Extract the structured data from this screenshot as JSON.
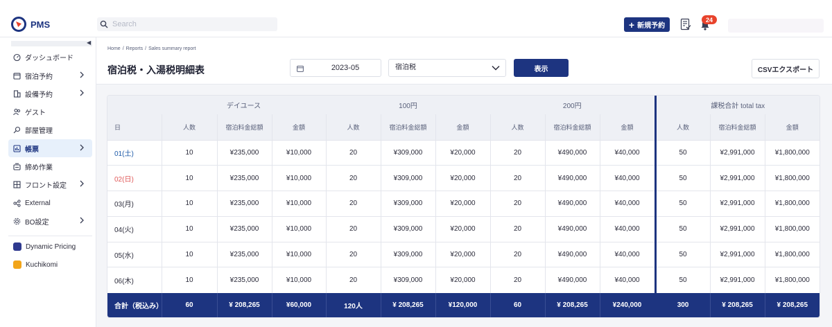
{
  "app": {
    "name": "PMS"
  },
  "topbar": {
    "search_placeholder": "Search",
    "new_reservation_label": "新規予約",
    "notification_count": "24"
  },
  "sidebar": {
    "items": [
      {
        "label": "ダッシュボード",
        "icon": "dashboard-icon",
        "chevron": false,
        "active": false
      },
      {
        "label": "宿泊予約",
        "icon": "calendar-icon",
        "chevron": true,
        "active": false
      },
      {
        "label": "設備予約",
        "icon": "building-icon",
        "chevron": true,
        "active": false
      },
      {
        "label": "ゲスト",
        "icon": "guests-icon",
        "chevron": false,
        "active": false
      },
      {
        "label": "部屋管理",
        "icon": "key-icon",
        "chevron": false,
        "active": false
      },
      {
        "label": "帳票",
        "icon": "report-icon",
        "chevron": true,
        "active": true
      },
      {
        "label": "締め作業",
        "icon": "register-icon",
        "chevron": false,
        "active": false
      },
      {
        "label": "フロント設定",
        "icon": "grid-icon",
        "chevron": true,
        "active": false
      },
      {
        "label": "External",
        "icon": "share-icon",
        "chevron": false,
        "active": false
      },
      {
        "label": "BO設定",
        "icon": "gear-icon",
        "chevron": true,
        "active": false
      }
    ],
    "apps": [
      {
        "label": "Dynamic Pricing",
        "icon": "dynamic-pricing-icon",
        "color": "#2f3a8f"
      },
      {
        "label": "Kuchikomi",
        "icon": "kuchikomi-icon",
        "color": "#f2a51a"
      }
    ]
  },
  "breadcrumb": [
    "Home",
    "Reports",
    "Sales summary report"
  ],
  "page": {
    "title": "宿泊税・入湯税明細表",
    "month_value": "2023-05",
    "tax_type_value": "宿泊税",
    "show_label": "表示",
    "csv_label": "CSVエクスポート"
  },
  "table": {
    "groups": [
      "デイユース",
      "100円",
      "200円",
      "課税合計 total tax"
    ],
    "day_header": "日",
    "sub_headers": [
      "人数",
      "宿泊料金総額",
      "金額"
    ],
    "rows": [
      {
        "day": "01(土)",
        "style": "blue",
        "cells": [
          "10",
          "¥235,000",
          "¥10,000",
          "20",
          "¥309,000",
          "¥20,000",
          "20",
          "¥490,000",
          "¥40,000",
          "50",
          "¥2,991,000",
          "¥1,800,000"
        ]
      },
      {
        "day": "02(日)",
        "style": "red",
        "cells": [
          "10",
          "¥235,000",
          "¥10,000",
          "20",
          "¥309,000",
          "¥20,000",
          "20",
          "¥490,000",
          "¥40,000",
          "50",
          "¥2,991,000",
          "¥1,800,000"
        ]
      },
      {
        "day": "03(月)",
        "style": "normal",
        "cells": [
          "10",
          "¥235,000",
          "¥10,000",
          "20",
          "¥309,000",
          "¥20,000",
          "20",
          "¥490,000",
          "¥40,000",
          "50",
          "¥2,991,000",
          "¥1,800,000"
        ]
      },
      {
        "day": "04(火)",
        "style": "normal",
        "cells": [
          "10",
          "¥235,000",
          "¥10,000",
          "20",
          "¥309,000",
          "¥20,000",
          "20",
          "¥490,000",
          "¥40,000",
          "50",
          "¥2,991,000",
          "¥1,800,000"
        ]
      },
      {
        "day": "05(水)",
        "style": "normal",
        "cells": [
          "10",
          "¥235,000",
          "¥10,000",
          "20",
          "¥309,000",
          "¥20,000",
          "20",
          "¥490,000",
          "¥40,000",
          "50",
          "¥2,991,000",
          "¥1,800,000"
        ]
      },
      {
        "day": "06(木)",
        "style": "normal",
        "cells": [
          "10",
          "¥235,000",
          "¥10,000",
          "20",
          "¥309,000",
          "¥20,000",
          "20",
          "¥490,000",
          "¥40,000",
          "50",
          "¥2,991,000",
          "¥1,800,000"
        ]
      }
    ],
    "total": {
      "label": "合計（税込み）",
      "cells": [
        "60",
        "¥ 208,265",
        "¥60,000",
        "120人",
        "¥ 208,265",
        "¥120,000",
        "60",
        "¥ 208,265",
        "¥240,000",
        "300",
        "¥ 208,265",
        "¥ 208,265"
      ]
    }
  },
  "colors": {
    "brand": "#1d3480",
    "accent": "#e8432c",
    "active_bg": "#e7f0fb",
    "sunday": "#e05a5a",
    "saturday": "#1d5aa8"
  }
}
